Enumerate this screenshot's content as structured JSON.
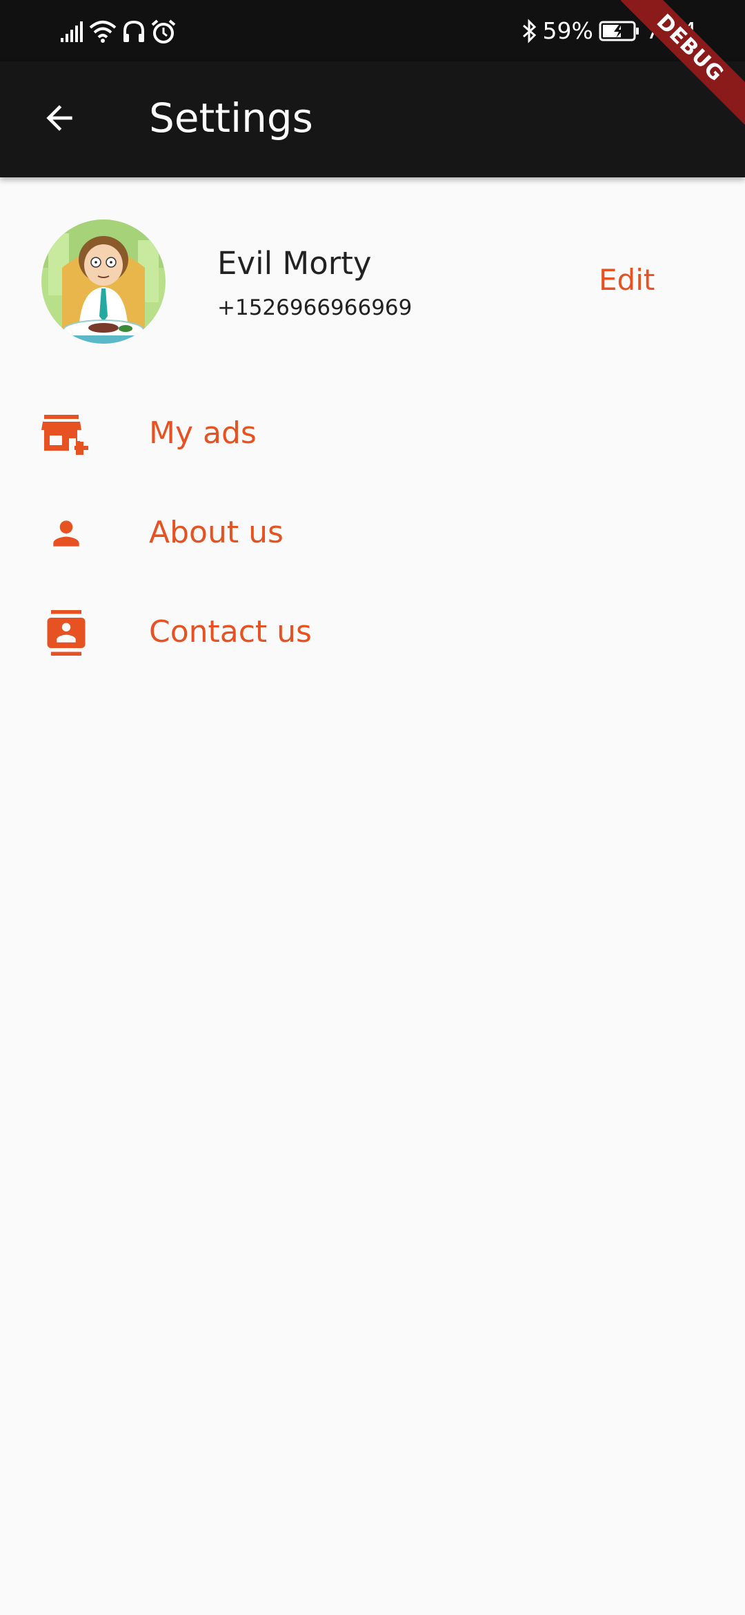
{
  "status_bar": {
    "bluetooth_icon": "bluetooth-icon",
    "battery_percent": "59%",
    "time": "7:54"
  },
  "debug_banner": {
    "label": "DEBUG"
  },
  "app_bar": {
    "title": "Settings",
    "back_icon": "arrow-back-icon"
  },
  "profile": {
    "name": "Evil Morty",
    "phone": "+1526966966969",
    "edit_label": "Edit"
  },
  "menu": {
    "items": [
      {
        "label": "My ads",
        "icon": "store-add-icon"
      },
      {
        "label": "About us",
        "icon": "person-icon"
      },
      {
        "label": "Contact us",
        "icon": "contact-card-icon"
      }
    ]
  },
  "colors": {
    "accent": "#e65221",
    "app_bar": "#161616",
    "status_bar": "#111111",
    "background": "#fafafa",
    "debug_banner": "#8b1a1a"
  }
}
